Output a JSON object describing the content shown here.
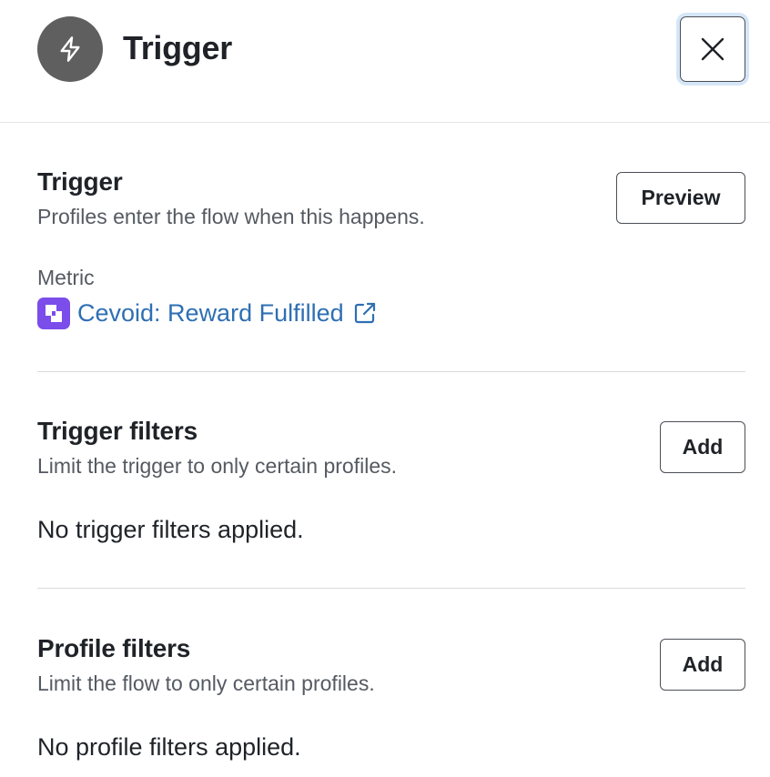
{
  "header": {
    "title": "Trigger",
    "icon": "lightning-bolt-icon",
    "close_icon": "close-icon"
  },
  "trigger_section": {
    "title": "Trigger",
    "description": "Profiles enter the flow when this happens.",
    "preview_label": "Preview",
    "metric_label": "Metric",
    "metric": {
      "name": "Cevoid: Reward Fulfilled",
      "brand_icon": "cevoid-logo-icon",
      "link_icon": "external-link-icon"
    }
  },
  "trigger_filters": {
    "title": "Trigger filters",
    "description": "Limit the trigger to only certain profiles.",
    "add_label": "Add",
    "empty_text": "No trigger filters applied."
  },
  "profile_filters": {
    "title": "Profile filters",
    "description": "Limit the flow to only certain profiles.",
    "add_label": "Add",
    "empty_text": "No profile filters applied."
  },
  "colors": {
    "link": "#2f6fb3",
    "brand": "#7b4dea",
    "header_icon_bg": "#5f5f5f",
    "focus_ring": "#d5e6f7"
  }
}
